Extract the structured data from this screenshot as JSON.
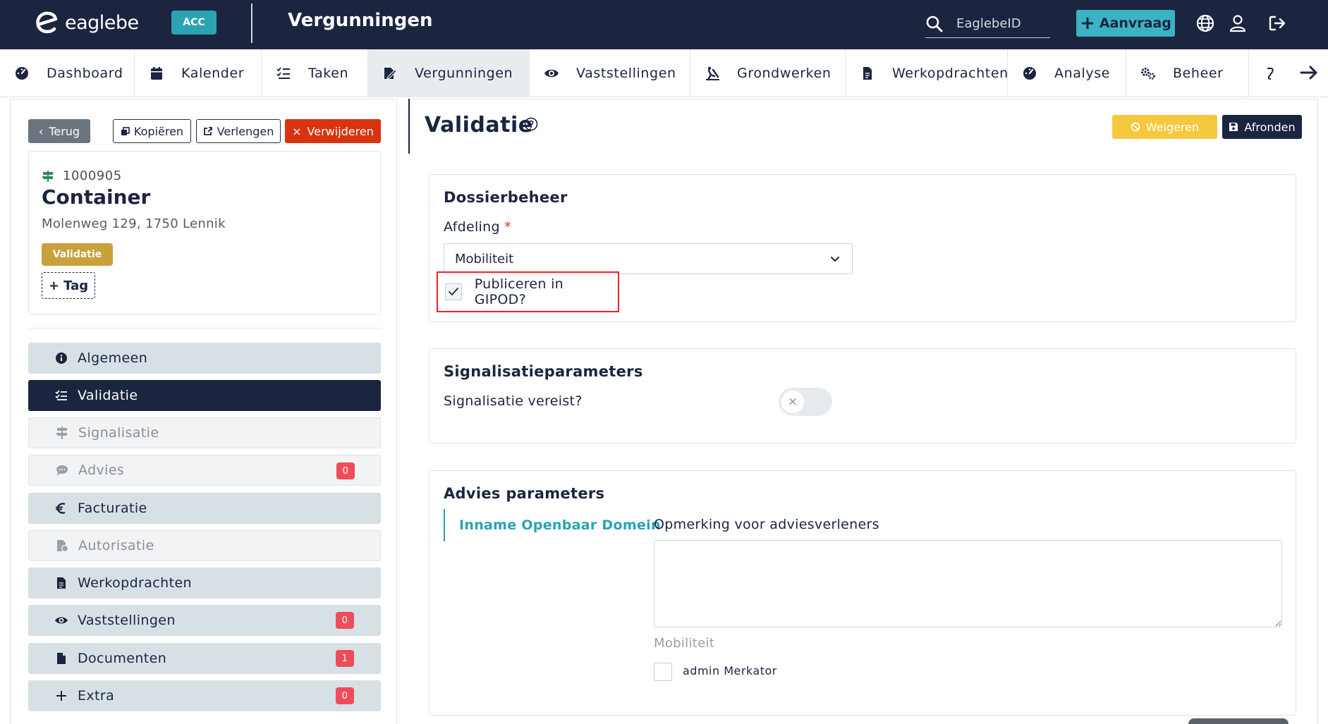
{
  "header": {
    "logo_text": "eaglebe",
    "env_badge": "ACC",
    "title": "Vergunningen",
    "search_placeholder": "EaglebeID",
    "new_button_label": "Aanvraag",
    "icons": [
      "globe-icon",
      "user-icon",
      "logout-icon"
    ]
  },
  "nav": {
    "items": [
      {
        "label": "Dashboard",
        "icon": "dashboard-icon"
      },
      {
        "label": "Kalender",
        "icon": "calendar-icon"
      },
      {
        "label": "Taken",
        "icon": "tasks-icon"
      },
      {
        "label": "Vergunningen",
        "icon": "permits-icon",
        "active": true
      },
      {
        "label": "Vaststellingen",
        "icon": "eye-icon"
      },
      {
        "label": "Grondwerken",
        "icon": "digging-icon"
      },
      {
        "label": "Werkopdrachten",
        "icon": "file-icon"
      },
      {
        "label": "Analyse",
        "icon": "dashboard-icon"
      },
      {
        "label": "Beheer",
        "icon": "cogs-icon"
      }
    ]
  },
  "actions": {
    "back": "Terug",
    "copy": "Kopiëren",
    "extend": "Verlengen",
    "delete": "Verwijderen"
  },
  "dossier": {
    "id": "1000905",
    "title": "Container",
    "address": "Molenweg 129, 1750 Lennik",
    "status": "Validatie",
    "tag_button": "+ Tag"
  },
  "sidebar": {
    "items": [
      {
        "label": "Algemeen",
        "icon": "info-icon",
        "state": "normal"
      },
      {
        "label": "Validatie",
        "icon": "checklist-icon",
        "state": "active"
      },
      {
        "label": "Signalisatie",
        "icon": "signpost-icon",
        "state": "disabled"
      },
      {
        "label": "Advies",
        "icon": "comments-icon",
        "state": "disabled",
        "count": "0"
      },
      {
        "label": "Facturatie",
        "icon": "euro-icon",
        "state": "normal"
      },
      {
        "label": "Autorisatie",
        "icon": "file-signature-icon",
        "state": "disabled"
      },
      {
        "label": "Werkopdrachten",
        "icon": "file-icon",
        "state": "normal"
      },
      {
        "label": "Vaststellingen",
        "icon": "eye-icon",
        "state": "normal",
        "count": "0"
      },
      {
        "label": "Documenten",
        "icon": "document-icon",
        "state": "normal",
        "count": "1"
      },
      {
        "label": "Extra",
        "icon": "plus-icon",
        "state": "normal",
        "count": "0"
      }
    ]
  },
  "main": {
    "title": "Validatie",
    "reject_button": "Weigeren",
    "finish_button": "Afronden",
    "dossierbeheer": {
      "title": "Dossierbeheer",
      "department_label": "Afdeling",
      "required_marker": "*",
      "department_value": "Mobiliteit",
      "gipod_label": "Publiceren in GIPOD?",
      "gipod_checked": true
    },
    "signalisatie": {
      "title": "Signalisatieparameters",
      "required_label": "Signalisatie vereist?",
      "required_value": false
    },
    "advies": {
      "title": "Advies parameters",
      "tab_label": "Inname Openbaar Domein",
      "remark_label": "Opmerking voor adviesverleners",
      "remark_value": "",
      "group_label": "Mobiliteit",
      "advisor_label": "admin Merkator",
      "advisor_checked": false
    }
  },
  "colors": {
    "navy": "#1b2540",
    "teal": "#2aa3b2",
    "danger": "#d9330f",
    "warning": "#f6c83e",
    "status_gold": "#c9a03b",
    "badge_red": "#ee4c5a",
    "highlight_red": "#e0262f"
  }
}
